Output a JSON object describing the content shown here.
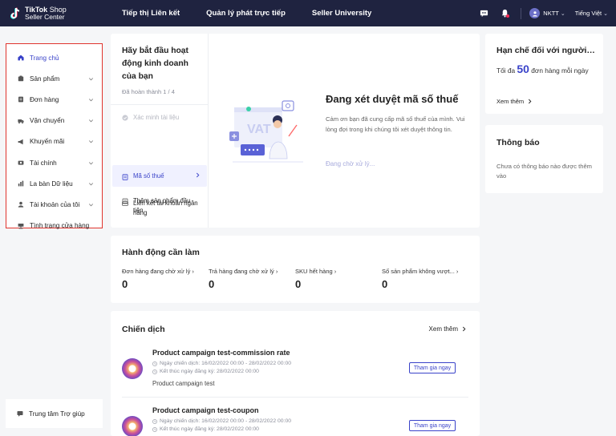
{
  "brand": {
    "name_bold": "TikTok",
    "name_light": "Shop",
    "subtitle": "Seller Center"
  },
  "topnav": [
    "Tiếp thị Liên kết",
    "Quản lý phát trực tiếp",
    "Seller University"
  ],
  "user": {
    "name": "NKTT",
    "language": "Tiếng Việt"
  },
  "sidebar": {
    "items": [
      {
        "label": "Trang chủ",
        "icon": "home-icon",
        "active": true
      },
      {
        "label": "Sản phẩm",
        "icon": "product-icon"
      },
      {
        "label": "Đơn hàng",
        "icon": "order-icon"
      },
      {
        "label": "Vận chuyển",
        "icon": "truck-icon"
      },
      {
        "label": "Khuyến mãi",
        "icon": "megaphone-icon"
      },
      {
        "label": "Tài chính",
        "icon": "finance-icon"
      },
      {
        "label": "La bàn Dữ liệu",
        "icon": "compass-icon"
      },
      {
        "label": "Tài khoản của tôi",
        "icon": "account-icon"
      },
      {
        "label": "Tình trạng cửa hàng",
        "icon": "shop-health-icon"
      }
    ],
    "help": "Trung tâm Trợ giúp"
  },
  "onboarding": {
    "title": "Hãy bắt đầu hoạt động kinh doanh của bạn",
    "progress": "Đã hoàn thành 1 / 4",
    "steps": [
      {
        "label": "Xác minh tài liệu",
        "state": "done"
      },
      {
        "label": "Mã số thuế",
        "state": "active"
      },
      {
        "label": "Thêm sản phẩm đầu tiên",
        "state": "todo"
      },
      {
        "label": "Liên kết tài khoản ngân hàng",
        "state": "todo"
      }
    ],
    "heading": "Đang xét duyệt mã số thuế",
    "description": "Cảm ơn bạn đã cung cấp mã số thuế của mình. Vui lòng đợi trong khi chúng tôi xét duyệt thông tin.",
    "status": "Đang chờ xử lý..."
  },
  "limit_card": {
    "title": "Hạn chế đối với người b...",
    "prefix": "Tối đa",
    "number": "50",
    "suffix": "đơn hàng mỗi ngày",
    "link": "Xem thêm"
  },
  "notice_card": {
    "title": "Thông báo",
    "text": "Chưa có thông báo nào được thêm vào"
  },
  "actions": {
    "title": "Hành động cần làm",
    "items": [
      {
        "label": "Đơn hàng đang chờ xử lý",
        "value": "0"
      },
      {
        "label": "Trả hàng đang chờ xử lý",
        "value": "0"
      },
      {
        "label": "SKU hết hàng",
        "value": "0"
      },
      {
        "label": "Số sản phẩm không vượt...",
        "value": "0"
      }
    ]
  },
  "campaigns": {
    "title": "Chiến dịch",
    "more": "Xem thêm",
    "items": [
      {
        "name": "Product campaign test-commission rate",
        "campaign_date": "Ngày chiến dịch: 16/02/2022 00:00 - 28/02/2022 00:00",
        "register_end": "Kết thúc ngày đăng ký: 28/02/2022 00:00",
        "desc": "Product campaign test",
        "button": "Tham gia ngay"
      },
      {
        "name": "Product campaign test-coupon",
        "campaign_date": "Ngày chiến dịch: 16/02/2022 00:00 - 28/02/2022 00:00",
        "register_end": "Kết thúc ngày đăng ký: 28/02/2022 00:00",
        "desc": "",
        "button": "Tham gia ngay"
      }
    ]
  },
  "colors": {
    "topbar": "#1f2340",
    "accent": "#3a43c9",
    "highlight": "#e0342e"
  }
}
